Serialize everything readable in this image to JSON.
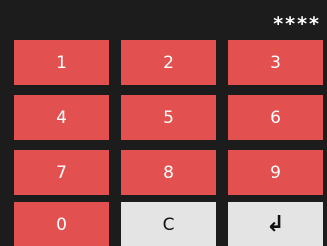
{
  "display": {
    "masked_pin": "****"
  },
  "keys": {
    "k1": "1",
    "k2": "2",
    "k3": "3",
    "k4": "4",
    "k5": "5",
    "k6": "6",
    "k7": "7",
    "k8": "8",
    "k9": "9",
    "k0": "0",
    "clear": "C",
    "enter": "↲"
  },
  "colors": {
    "background": "#1c1c1c",
    "key_red": "#e25050",
    "key_light": "#e4e4e4",
    "text_light": "#ffffff",
    "text_dark": "#111111"
  },
  "icons": {
    "enter": "enter-arrow-icon"
  }
}
